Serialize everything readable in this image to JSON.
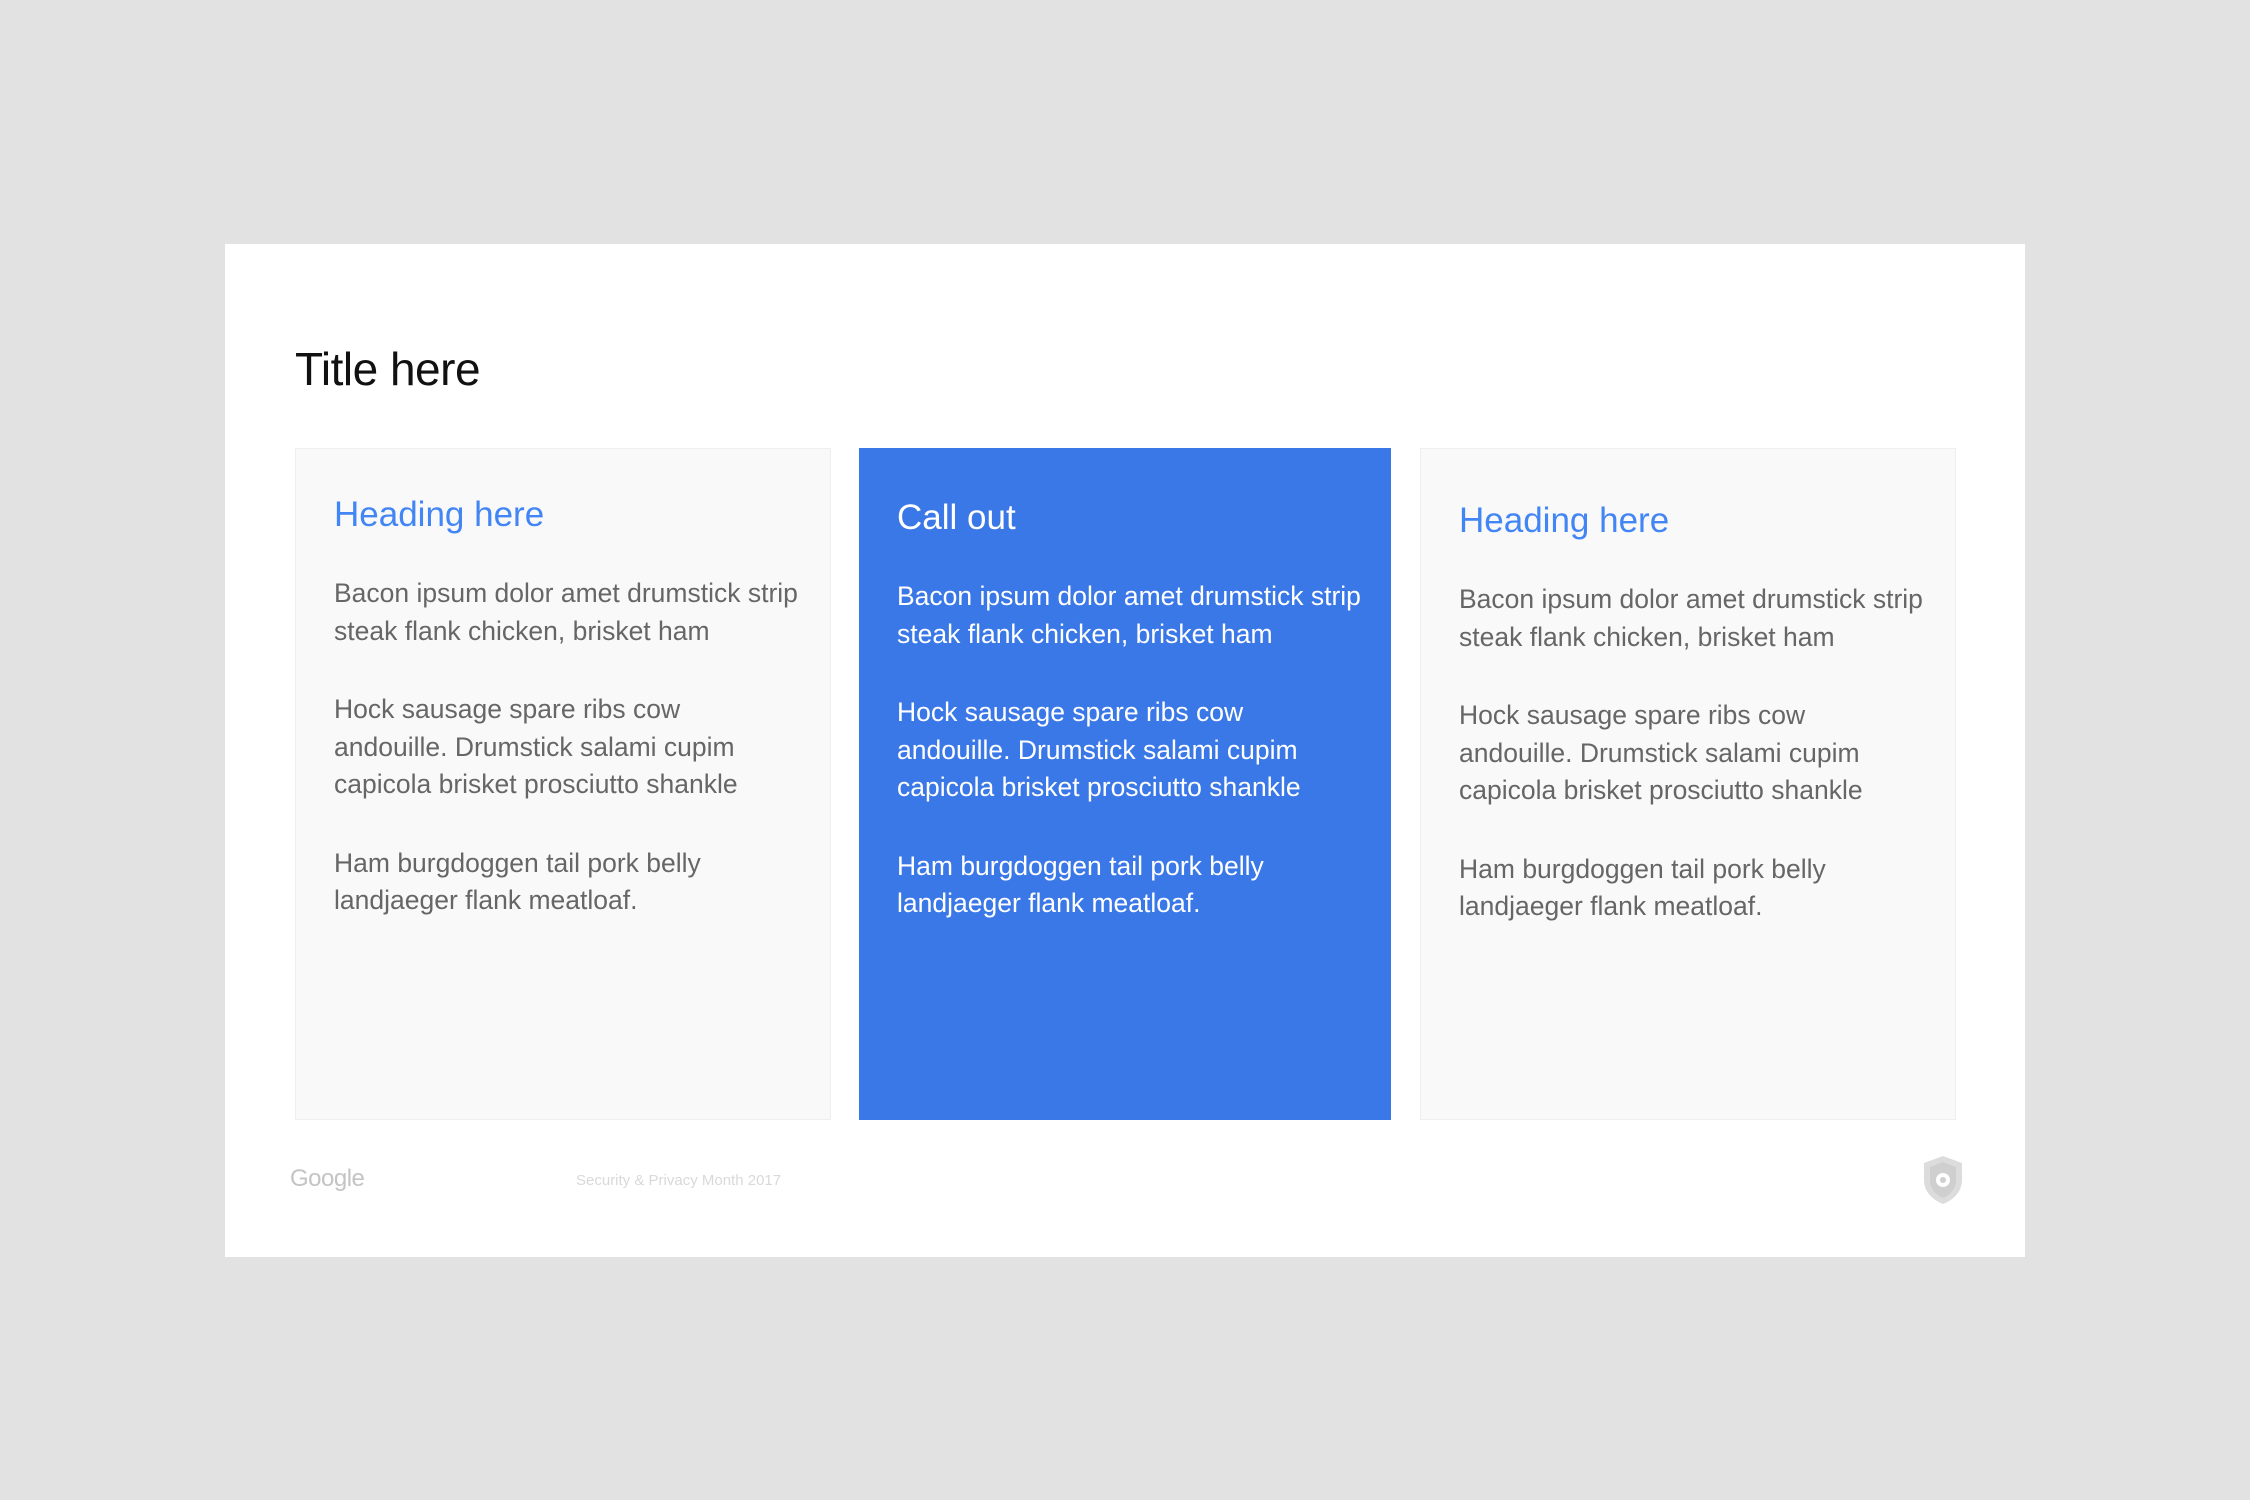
{
  "slide": {
    "title": "Title here"
  },
  "cards": [
    {
      "heading": "Heading here",
      "paragraphs": [
        "Bacon ipsum dolor amet drumstick strip steak flank chicken, brisket ham",
        "Hock sausage spare ribs cow andouille. Drumstick salami cupim capicola brisket prosciutto shankle",
        "Ham burgdoggen tail pork belly landjaeger flank meatloaf."
      ]
    },
    {
      "heading": "Call out",
      "paragraphs": [
        "Bacon ipsum dolor amet drumstick strip steak flank chicken, brisket ham",
        "Hock sausage spare ribs cow andouille. Drumstick salami cupim capicola brisket prosciutto shankle",
        "Ham burgdoggen tail pork belly landjaeger flank meatloaf."
      ]
    },
    {
      "heading": "Heading here",
      "paragraphs": [
        "Bacon ipsum dolor amet drumstick strip steak flank chicken, brisket ham",
        "Hock sausage spare ribs cow andouille. Drumstick salami cupim capicola brisket prosciutto shankle",
        "Ham burgdoggen tail pork belly landjaeger flank meatloaf."
      ]
    }
  ],
  "footer": {
    "logo_text": "Google",
    "event_text": "Security & Privacy Month 2017",
    "shield_icon": "shield-icon"
  },
  "colors": {
    "background": "#e2e2e2",
    "slide": "#ffffff",
    "accent_blue": "#4285f4",
    "callout_blue": "#3b78e7",
    "card_light": "#f9f9f9",
    "body_text": "#666666"
  }
}
